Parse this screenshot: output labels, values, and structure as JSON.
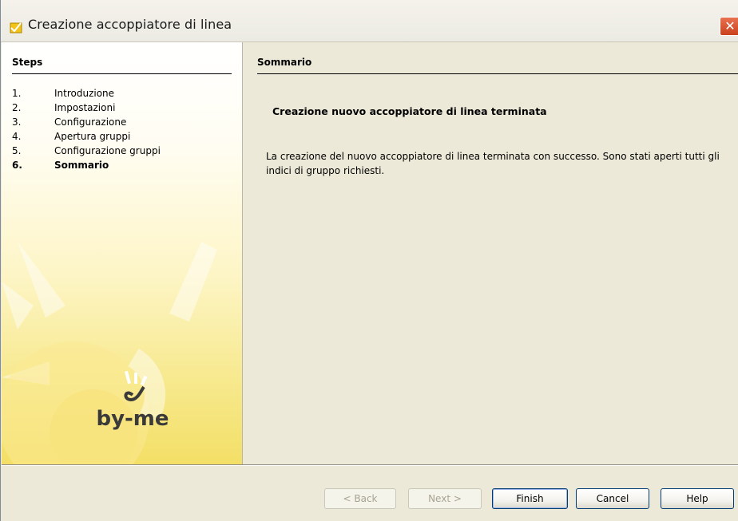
{
  "window": {
    "title": "Creazione accoppiatore di linea",
    "close_glyph": "✕"
  },
  "sidebar": {
    "heading": "Steps",
    "steps": [
      {
        "num": "1.",
        "label": "Introduzione"
      },
      {
        "num": "2.",
        "label": "Impostazioni"
      },
      {
        "num": "3.",
        "label": "Configurazione"
      },
      {
        "num": "4.",
        "label": "Apertura gruppi"
      },
      {
        "num": "5.",
        "label": "Configurazione gruppi"
      },
      {
        "num": "6.",
        "label": "Sommario"
      }
    ],
    "current_step": 6,
    "logo_text": "by-me"
  },
  "content": {
    "heading": "Sommario",
    "summary_title": "Creazione nuovo accoppiatore di linea terminata",
    "summary_text": "La creazione del nuovo accoppiatore di linea terminata con successo. Sono stati aperti tutti gli indici di gruppo richiesti."
  },
  "buttons": {
    "back": "< Back",
    "next": "Next >",
    "finish": "Finish",
    "cancel": "Cancel",
    "help": "Help"
  },
  "colors": {
    "sidebar_accent": "#f3df66",
    "button_border": "#003c74",
    "close_button": "#c9421d"
  }
}
